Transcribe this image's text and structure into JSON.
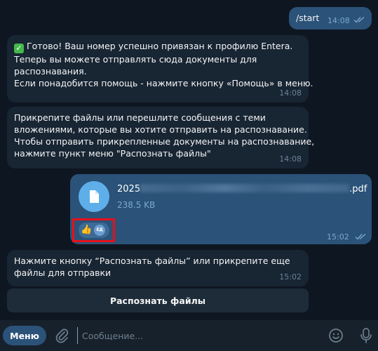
{
  "messages": {
    "start": {
      "text": "/start",
      "time": "14:08"
    },
    "linked": {
      "lines": [
        "Готово! Ваш номер успешно привязан к профилю Entera.",
        "Теперь вы можете отправлять сюда документы для",
        "распознавания.",
        "Если понадобится помощь - нажмите кнопку «Помощь» в меню."
      ],
      "time": "14:08"
    },
    "attach_hint": {
      "lines": [
        "Прикрепите файлы или перешлите сообщения с теми",
        "вложениями, которые вы хотите отправить на распознавание.",
        "Чтобы отправить прикрепленные документы на распознавание,",
        "нажмите пункт меню \"Распознать файлы\""
      ],
      "time": "14:08"
    },
    "file": {
      "name_prefix": "2025",
      "name_suffix": ".pdf",
      "size": "238.5 KB",
      "reaction_emoji": "👍",
      "reaction_avatar": "ЕД",
      "time": "15:02"
    },
    "recognize_prompt": {
      "lines": [
        "Нажмите кнопку “Распознать файлы” или прикрепите еще",
        "файлы для отправки"
      ],
      "time": "15:02"
    }
  },
  "keyboard": {
    "recognize_button": "Распознать файлы"
  },
  "composer": {
    "menu_label": "Меню",
    "placeholder": "Сообщение..."
  },
  "colors": {
    "background": "#0e1621",
    "incoming_bubble": "#182533",
    "outgoing_bubble": "#2b5278",
    "highlight": "#e8101a"
  }
}
